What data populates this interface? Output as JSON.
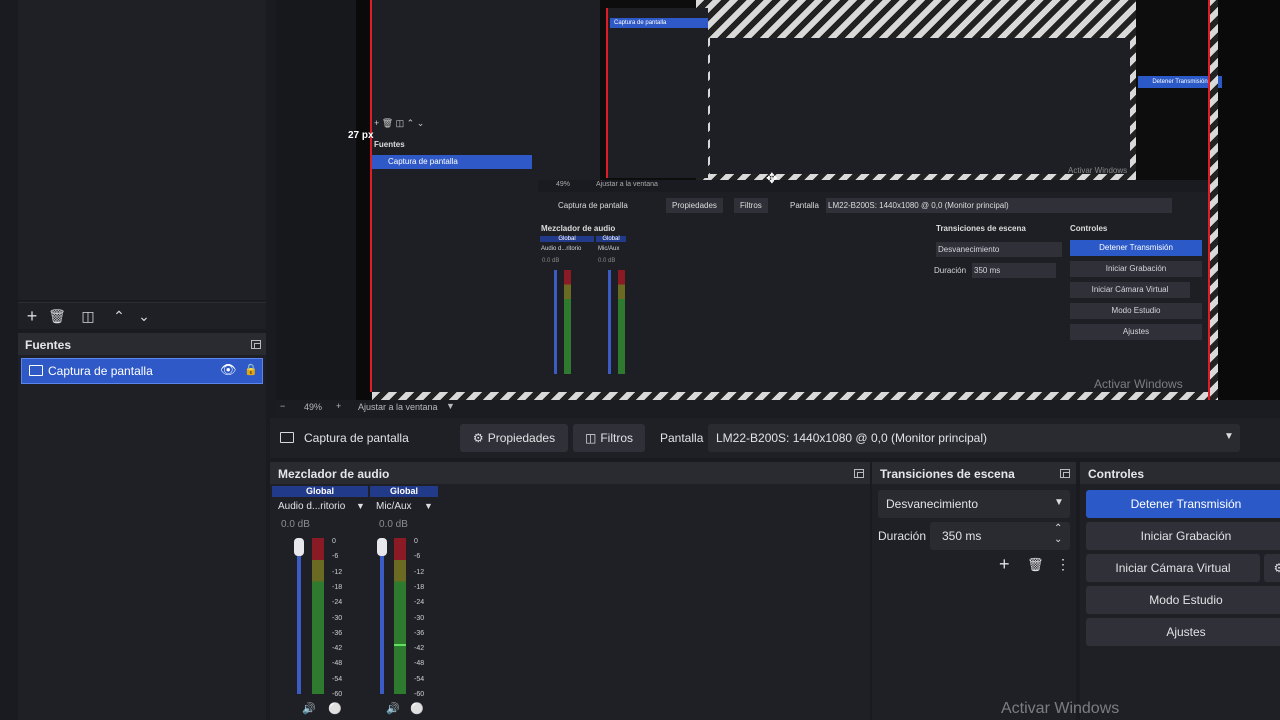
{
  "sources_panel": {
    "title": "Fuentes",
    "items": [
      {
        "label": "Captura de pantalla"
      }
    ]
  },
  "preview": {
    "dimension_label": "27 px",
    "watermark": "Activar Windows",
    "inner_sources": {
      "title": "Fuentes",
      "item": "Captura de pantalla"
    },
    "inner_context": {
      "source": "Captura de pantalla",
      "properties": "Propiedades",
      "filters": "Filtros",
      "display_label": "Pantalla",
      "display_value": "LM22-B200S: 1440x1080 @ 0,0 (Monitor principal)"
    },
    "inner_mixer": {
      "title": "Mezclador de audio",
      "global": "Global",
      "ch1": "Audio d...ritorio",
      "ch2": "Mic/Aux",
      "db": "0.0 dB"
    },
    "inner_transitions": {
      "title": "Transiciones de escena",
      "fade": "Desvanecimiento",
      "duration_label": "Duración",
      "duration": "350 ms"
    },
    "inner_controls": {
      "title": "Controles",
      "stop": "Detener Transmisión",
      "record": "Iniciar Grabación",
      "vcam": "Iniciar Cámara Virtual",
      "studio": "Modo Estudio",
      "settings": "Ajustes"
    },
    "inner_zoom": "49%",
    "inner_fit": "Ajustar a la ventana"
  },
  "zoom_bar": {
    "zoom": "49%",
    "fit": "Ajustar a la ventana"
  },
  "context_bar": {
    "source_name": "Captura de pantalla",
    "properties": "Propiedades",
    "filters": "Filtros",
    "display_label": "Pantalla",
    "display_value": "LM22-B200S: 1440x1080 @ 0,0 (Monitor principal)"
  },
  "audio_mixer": {
    "title": "Mezclador de audio",
    "channels": [
      {
        "tag": "Global",
        "name": "Audio d...ritorio",
        "db": "0.0 dB"
      },
      {
        "tag": "Global",
        "name": "Mic/Aux",
        "db": "0.0 dB"
      }
    ],
    "scale": [
      "0",
      "-6",
      "-12",
      "-18",
      "-24",
      "-30",
      "-36",
      "-42",
      "-48",
      "-54",
      "-60"
    ]
  },
  "transitions": {
    "title": "Transiciones de escena",
    "selected": "Desvanecimiento",
    "duration_label": "Duración",
    "duration_value": "350 ms"
  },
  "controls": {
    "title": "Controles",
    "stop_stream": "Detener Transmisión",
    "start_recording": "Iniciar Grabación",
    "start_virtual_cam": "Iniciar Cámara Virtual",
    "studio_mode": "Modo Estudio",
    "settings": "Ajustes"
  },
  "watermark": "Activar Windows",
  "colors": {
    "accent": "#2b5ac8",
    "preview_border": "#e01c24",
    "meter_green": "#3aa83a",
    "meter_yellow": "#9a9a2a",
    "meter_red": "#8a1a24"
  }
}
